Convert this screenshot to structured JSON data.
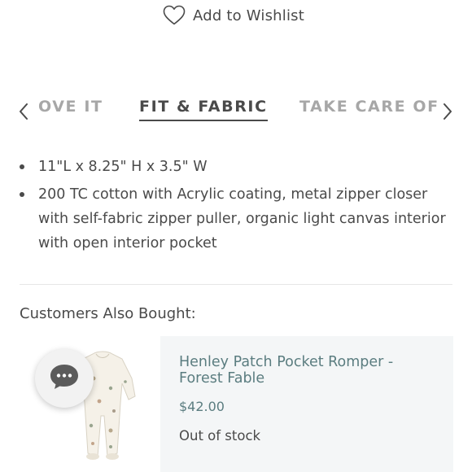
{
  "wishlist": {
    "label": "Add to Wishlist",
    "icon": "heart-outline-icon"
  },
  "tabs": {
    "items": [
      {
        "label": "OVE IT",
        "active": false
      },
      {
        "label": "FIT & FABRIC",
        "active": true
      },
      {
        "label": "TAKE CARE OF",
        "active": false
      }
    ],
    "prev_icon": "chevron-left-icon",
    "next_icon": "chevron-right-icon"
  },
  "details": {
    "items": [
      "11\"L x 8.25\" H x 3.5\" W",
      "200 TC cotton with Acrylic coating, metal zipper closer with self-fabric zipper puller, organic light canvas interior with open interior pocket"
    ]
  },
  "also_bought": {
    "heading": "Customers Also Bought:",
    "products": [
      {
        "title": "Henley Patch Pocket Romper - Forest Fable",
        "price": "$42.00",
        "stock": "Out of stock",
        "image_icon": "romper-product-image"
      }
    ]
  },
  "chat": {
    "icon": "chat-bubble-icon"
  },
  "colors": {
    "text": "#4a4a4a",
    "muted_tab": "#a7a7a7",
    "accent": "#5b7d80",
    "card_bg": "#f4f6f7"
  }
}
